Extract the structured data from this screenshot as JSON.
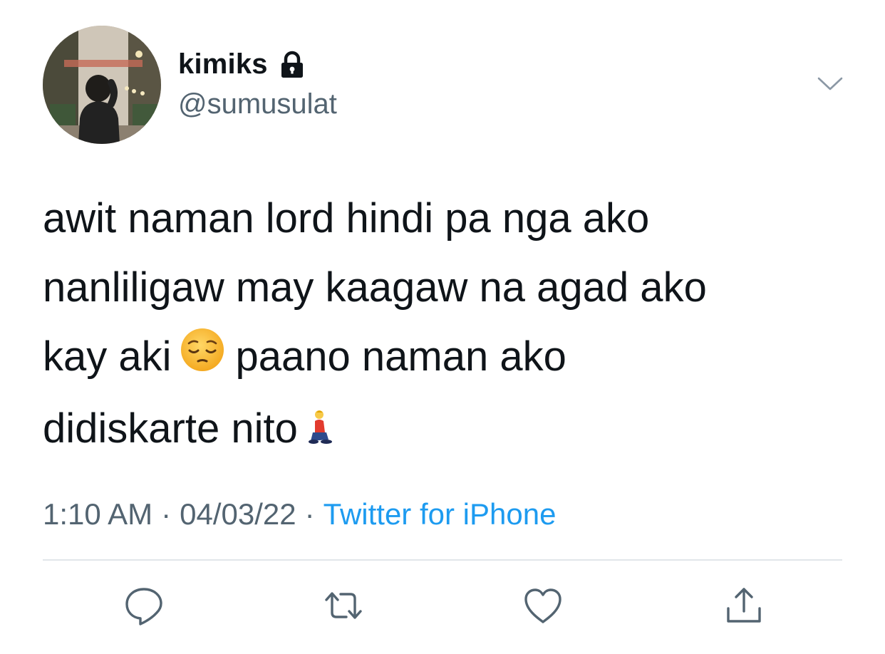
{
  "user": {
    "display_name": "kimiks",
    "handle": "@sumusulat",
    "protected_icon": "lock-icon",
    "avatar_icon": "profile-photo"
  },
  "tweet": {
    "lines": [
      {
        "text": "awit naman lord hindi pa nga ako"
      },
      {
        "text": "nanliligaw may kaagaw na agad ako"
      },
      {
        "before": "kay aki",
        "emoji": "pensive-face-emoji",
        "after": "paano naman ako"
      },
      {
        "before": "didiskarte nito",
        "emoji": "person-kneeling-emoji"
      }
    ]
  },
  "meta": {
    "time": "1:10 AM",
    "date": "04/03/22",
    "separator": "·",
    "source": "Twitter for iPhone"
  },
  "actions": [
    {
      "icon": "reply-icon"
    },
    {
      "icon": "retweet-icon"
    },
    {
      "icon": "like-icon"
    },
    {
      "icon": "share-icon"
    }
  ],
  "colors": {
    "text_primary": "#0f1419",
    "text_secondary": "#536471",
    "link": "#1d9bf0",
    "divider": "#e1e6ea"
  }
}
